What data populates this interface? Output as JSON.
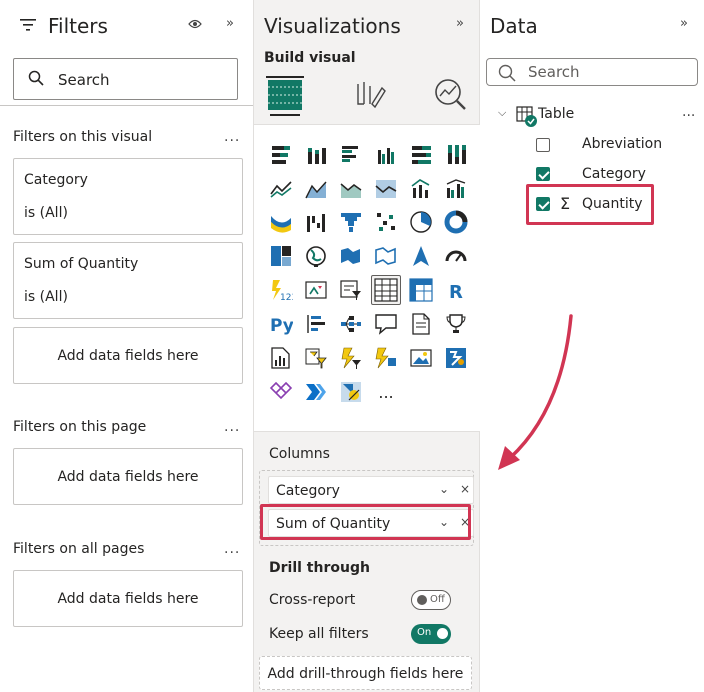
{
  "filters_pane": {
    "title": "Filters",
    "search_placeholder": "Search",
    "sections": {
      "visual": {
        "label": "Filters on this visual",
        "more": "..."
      },
      "page": {
        "label": "Filters on this page",
        "more": "..."
      },
      "all_pages": {
        "label": "Filters on all pages",
        "more": "..."
      }
    },
    "visual_filters": [
      {
        "name": "Category",
        "condition": "is (All)"
      },
      {
        "name": "Sum of Quantity",
        "condition": "is (All)"
      }
    ],
    "add_fields_label": "Add data fields here",
    "icons": {
      "title": "filter-lines-icon",
      "eye": "eye-icon",
      "collapse": "double-chevron-right-icon",
      "search": "search-icon"
    }
  },
  "viz_pane": {
    "title": "Visualizations",
    "build_label": "Build visual",
    "build_tabs": [
      "build-visual-tab",
      "format-visual-tab",
      "analytics-tab"
    ],
    "visual_icons": [
      "stacked-bar-chart-icon",
      "stacked-column-chart-icon",
      "clustered-bar-chart-icon",
      "clustered-column-chart-icon",
      "100-stacked-bar-chart-icon",
      "100-stacked-column-chart-icon",
      "line-chart-icon",
      "area-chart-icon",
      "stacked-area-chart-icon",
      "100-stacked-area-chart-icon",
      "line-and-stacked-column-icon",
      "line-and-clustered-column-icon",
      "ribbon-chart-icon",
      "waterfall-chart-icon",
      "funnel-chart-icon",
      "scatter-chart-icon",
      "pie-chart-icon",
      "donut-chart-icon",
      "treemap-icon",
      "map-icon",
      "filled-map-icon",
      "shape-map-icon",
      "azure-map-icon",
      "gauge-icon",
      "card-icon",
      "kpi-icon",
      "slicer-icon",
      "table-icon",
      "matrix-icon",
      "r-script-visual-icon",
      "python-visual-icon",
      "key-influencers-icon",
      "decomposition-tree-icon",
      "qa-icon",
      "smart-narrative-icon",
      "metrics-icon",
      "paginated-report-icon",
      "button-slicer-icon",
      "powerapps-icon",
      "power-automate-icon",
      "image-icon",
      "arcgis-icon",
      "appsource-icon",
      "power-automate-flow-icon",
      "custom-visual-icon",
      "more-visuals-icon"
    ],
    "more_label": "...",
    "columns_label": "Columns",
    "column_fields": [
      "Category",
      "Sum of Quantity"
    ],
    "drill_through": {
      "title": "Drill through",
      "cross_report": {
        "label": "Cross-report",
        "state": "Off"
      },
      "keep_all_filters": {
        "label": "Keep all filters",
        "state": "On"
      },
      "add_label": "Add drill-through fields here"
    },
    "accent": "#117865",
    "highlight": "#d13553"
  },
  "data_pane": {
    "title": "Data",
    "search_placeholder": "Search",
    "table": {
      "name": "Table",
      "more": "..."
    },
    "fields": [
      {
        "name": "Abreviation",
        "checked": false,
        "sigma": false
      },
      {
        "name": "Category",
        "checked": true,
        "sigma": false
      },
      {
        "name": "Quantity",
        "checked": true,
        "sigma": true
      }
    ],
    "sigma_glyph": "Σ"
  }
}
